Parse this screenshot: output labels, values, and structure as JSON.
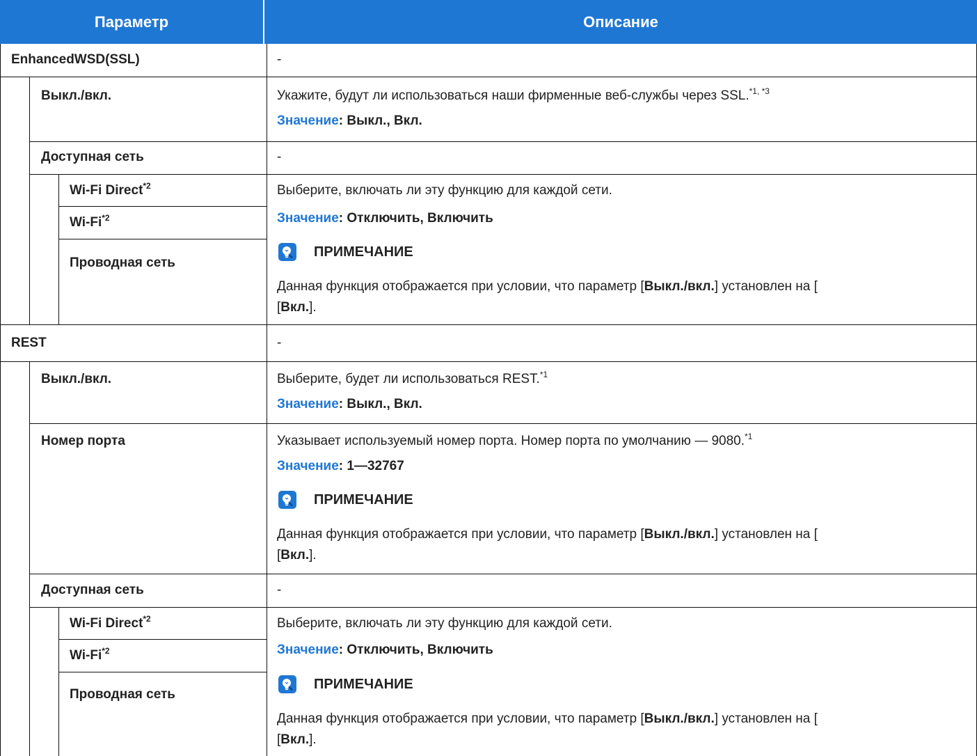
{
  "header": {
    "param": "Параметр",
    "desc": "Описание"
  },
  "value_label": "Значение",
  "dash": "-",
  "note": {
    "title": "ПРИМЕЧАНИЕ",
    "text_1": "Данная функция отображается при условии, что параметр [",
    "text_bold_1": "Выкл./вкл.",
    "text_2": "] установлен на [",
    "text_bold_2": "Вкл.",
    "text_3": "]."
  },
  "rows": {
    "ewsd": {
      "name": "EnhancedWSD(SSL)"
    },
    "ewsd_onoff": {
      "name": "Выкл./вкл.",
      "desc": "Укажите, будут ли использоваться наши фирменные веб-службы через SSL.",
      "sup": "*1, *3",
      "value": ": Выкл., Вкл."
    },
    "ewsd_net": {
      "name": "Доступная сеть"
    },
    "ewsd_wfd": {
      "name": "Wi-Fi Direct",
      "sup": "*2"
    },
    "ewsd_wifi": {
      "name": "Wi-Fi",
      "sup": "*2"
    },
    "ewsd_wired": {
      "name": "Проводная сеть"
    },
    "ewsd_net_desc": {
      "desc": "Выберите, включать ли эту функцию для каждой сети.",
      "value": ": Отключить, Включить"
    },
    "rest": {
      "name": "REST"
    },
    "rest_onoff": {
      "name": "Выкл./вкл.",
      "desc": "Выберите, будет ли использоваться REST.",
      "sup": "*1",
      "value": ": Выкл., Вкл."
    },
    "rest_port": {
      "name": "Номер порта",
      "desc": "Указывает используемый номер порта. Номер порта по умолчанию — 9080.",
      "sup": "*1",
      "value": ": 1—32767"
    },
    "rest_net": {
      "name": "Доступная сеть"
    },
    "rest_wfd": {
      "name": "Wi-Fi Direct",
      "sup": "*2"
    },
    "rest_wifi": {
      "name": "Wi-Fi",
      "sup": "*2"
    },
    "rest_wired": {
      "name": "Проводная сеть"
    },
    "rest_net_desc": {
      "desc": "Выберите, включать ли эту функцию для каждой сети.",
      "value": ": Отключить, Включить"
    }
  }
}
